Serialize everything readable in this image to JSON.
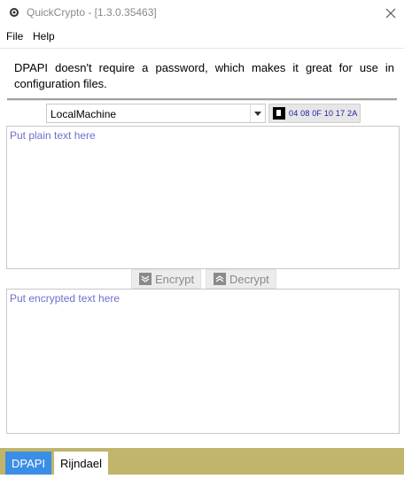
{
  "window": {
    "title": "QuickCrypto - [1.3.0.35463]"
  },
  "menu": {
    "items": [
      "File",
      "Help"
    ]
  },
  "description": "DPAPI doesn't require a password, which makes it great for use in configuration files.",
  "scope": {
    "selected": "LocalMachine"
  },
  "entropy": {
    "value": "04 08 0F 10 17 2A"
  },
  "plain_text": {
    "placeholder": "Put plain text here"
  },
  "encrypted_text": {
    "placeholder": "Put encrypted text here"
  },
  "actions": {
    "encrypt_label": "Encrypt",
    "decrypt_label": "Decrypt"
  },
  "tabs": [
    {
      "label": "DPAPI",
      "active": true
    },
    {
      "label": "Rijndael",
      "active": false
    }
  ],
  "colors": {
    "active_tab": "#3a8ee6",
    "tab_bar": "#c0b56a",
    "placeholder": "#6f6fd0",
    "entropy_text": "#1a1aa6"
  },
  "icons": {
    "app": "gear-icon",
    "close": "close-icon",
    "dropdown": "chevron-down-icon",
    "entropy": "key-icon",
    "encrypt": "lock-icon",
    "decrypt": "unlock-icon"
  }
}
